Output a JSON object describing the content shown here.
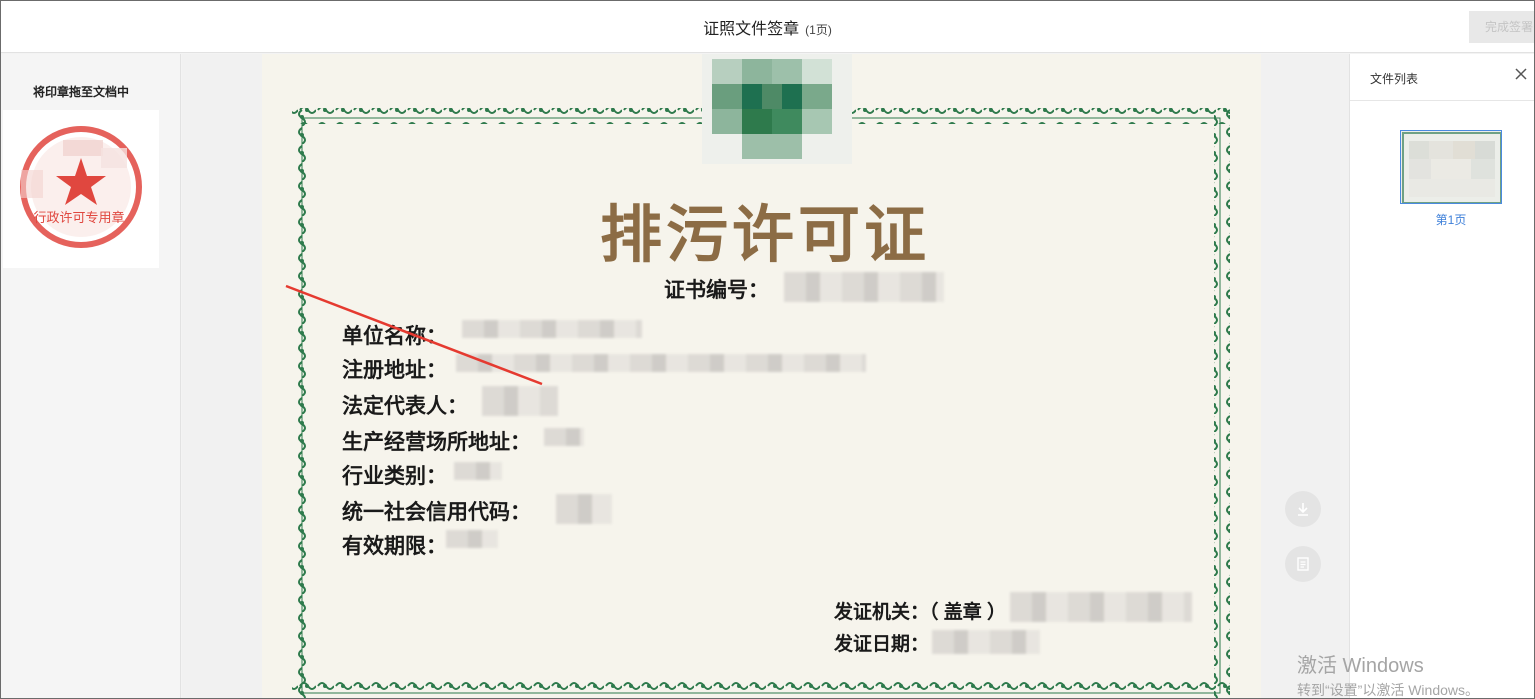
{
  "header": {
    "title": "证照文件签章",
    "page_count": "(1页)",
    "finish_button": "完成签署"
  },
  "left_panel": {
    "title": "将印章拖至文档中",
    "seal_text": "行政许可专用章"
  },
  "document": {
    "cert_title": "排污许可证",
    "cert_number_label": "证书编号：",
    "fields": [
      "单位名称：",
      "注册地址：",
      "法定代表人：",
      "生产经营场所地址：",
      "行业类别：",
      "统一社会信用代码：",
      "有效期限："
    ],
    "issuer_label": "发证机关：（ 盖章 ）",
    "issue_date_label": "发证日期："
  },
  "right_panel": {
    "title": "文件列表",
    "thumbnail_label": "第1页"
  },
  "watermark": {
    "line1": "激活 Windows",
    "line2": "转到“设置”以激活 Windows。"
  },
  "colors": {
    "accent_blue": "#3d7fd9",
    "seal_red": "#e0473f",
    "cert_title": "#8c6c45",
    "border_green": "#2e7a4c"
  }
}
